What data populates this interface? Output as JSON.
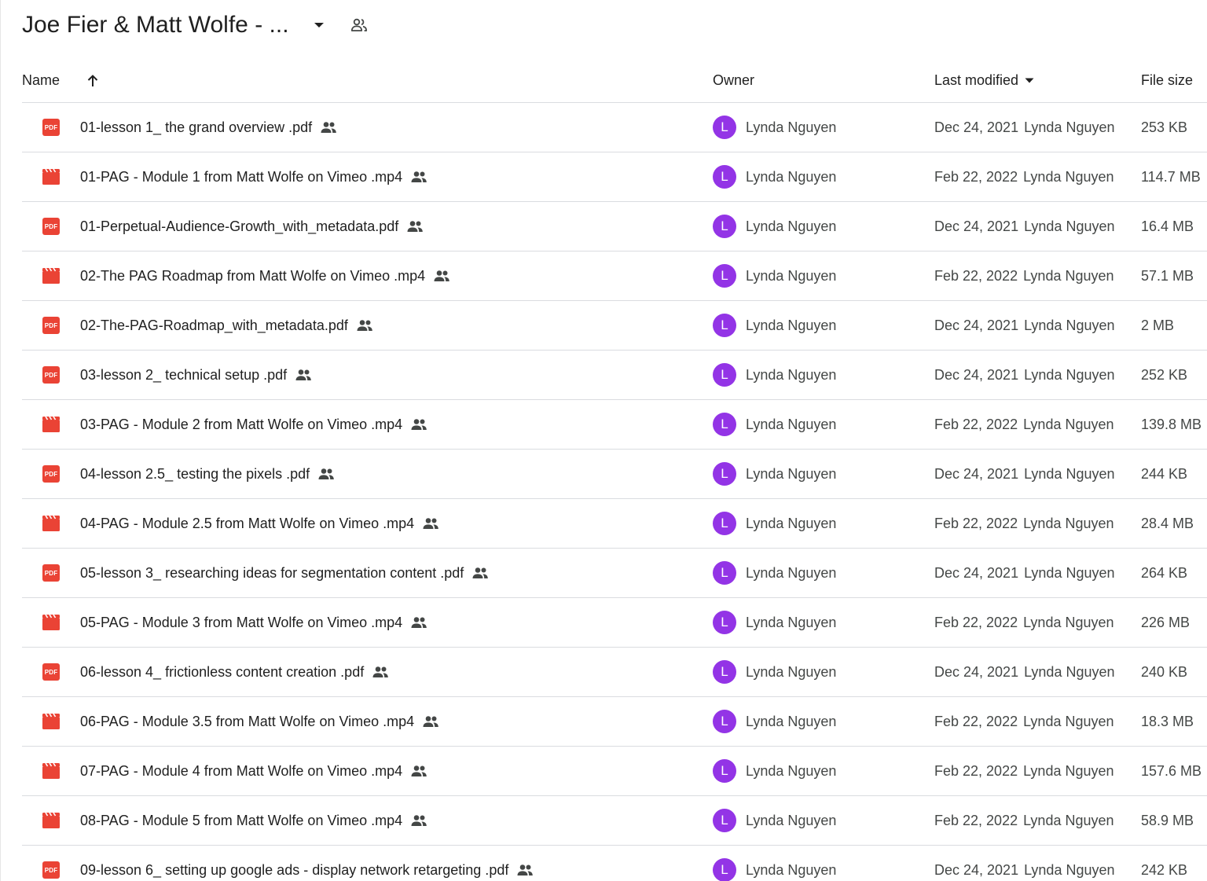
{
  "folder": {
    "title": "Joe Fier & Matt Wolfe - ..."
  },
  "columns": {
    "name": "Name",
    "owner": "Owner",
    "last_modified": "Last modified",
    "file_size": "File size"
  },
  "colors": {
    "pdf": "#ea4335",
    "video": "#ea4335",
    "avatar": "#9334e6",
    "divider": "#dadce0"
  },
  "files": [
    {
      "name": "01-lesson 1_ the grand overview .pdf",
      "type": "pdf",
      "icon": "pdf-icon",
      "owner_initial": "L",
      "owner": "Lynda Nguyen",
      "modified_date": "Dec 24, 2021",
      "modified_by": "Lynda Nguyen",
      "size": "253 KB"
    },
    {
      "name": "01-PAG - Module 1 from Matt Wolfe on Vimeo .mp4",
      "type": "video",
      "icon": "video-icon",
      "owner_initial": "L",
      "owner": "Lynda Nguyen",
      "modified_date": "Feb 22, 2022",
      "modified_by": "Lynda Nguyen",
      "size": "114.7 MB"
    },
    {
      "name": "01-Perpetual-Audience-Growth_with_metadata.pdf",
      "type": "pdf",
      "icon": "pdf-icon",
      "owner_initial": "L",
      "owner": "Lynda Nguyen",
      "modified_date": "Dec 24, 2021",
      "modified_by": "Lynda Nguyen",
      "size": "16.4 MB"
    },
    {
      "name": "02-The PAG Roadmap from Matt Wolfe on Vimeo .mp4",
      "type": "video",
      "icon": "video-icon",
      "owner_initial": "L",
      "owner": "Lynda Nguyen",
      "modified_date": "Feb 22, 2022",
      "modified_by": "Lynda Nguyen",
      "size": "57.1 MB"
    },
    {
      "name": "02-The-PAG-Roadmap_with_metadata.pdf",
      "type": "pdf",
      "icon": "pdf-icon",
      "owner_initial": "L",
      "owner": "Lynda Nguyen",
      "modified_date": "Dec 24, 2021",
      "modified_by": "Lynda Nguyen",
      "size": "2 MB"
    },
    {
      "name": "03-lesson 2_ technical setup .pdf",
      "type": "pdf",
      "icon": "pdf-icon",
      "owner_initial": "L",
      "owner": "Lynda Nguyen",
      "modified_date": "Dec 24, 2021",
      "modified_by": "Lynda Nguyen",
      "size": "252 KB"
    },
    {
      "name": "03-PAG - Module 2 from Matt Wolfe on Vimeo .mp4",
      "type": "video",
      "icon": "video-icon",
      "owner_initial": "L",
      "owner": "Lynda Nguyen",
      "modified_date": "Feb 22, 2022",
      "modified_by": "Lynda Nguyen",
      "size": "139.8 MB"
    },
    {
      "name": "04-lesson 2.5_ testing the pixels .pdf",
      "type": "pdf",
      "icon": "pdf-icon",
      "owner_initial": "L",
      "owner": "Lynda Nguyen",
      "modified_date": "Dec 24, 2021",
      "modified_by": "Lynda Nguyen",
      "size": "244 KB"
    },
    {
      "name": "04-PAG - Module 2.5 from Matt Wolfe on Vimeo .mp4",
      "type": "video",
      "icon": "video-icon",
      "owner_initial": "L",
      "owner": "Lynda Nguyen",
      "modified_date": "Feb 22, 2022",
      "modified_by": "Lynda Nguyen",
      "size": "28.4 MB"
    },
    {
      "name": "05-lesson 3_ researching ideas for segmentation content .pdf",
      "type": "pdf",
      "icon": "pdf-icon",
      "owner_initial": "L",
      "owner": "Lynda Nguyen",
      "modified_date": "Dec 24, 2021",
      "modified_by": "Lynda Nguyen",
      "size": "264 KB"
    },
    {
      "name": "05-PAG - Module 3 from Matt Wolfe on Vimeo .mp4",
      "type": "video",
      "icon": "video-icon",
      "owner_initial": "L",
      "owner": "Lynda Nguyen",
      "modified_date": "Feb 22, 2022",
      "modified_by": "Lynda Nguyen",
      "size": "226 MB"
    },
    {
      "name": "06-lesson 4_ frictionless content creation .pdf",
      "type": "pdf",
      "icon": "pdf-icon",
      "owner_initial": "L",
      "owner": "Lynda Nguyen",
      "modified_date": "Dec 24, 2021",
      "modified_by": "Lynda Nguyen",
      "size": "240 KB"
    },
    {
      "name": "06-PAG - Module 3.5 from Matt Wolfe on Vimeo .mp4",
      "type": "video",
      "icon": "video-icon",
      "owner_initial": "L",
      "owner": "Lynda Nguyen",
      "modified_date": "Feb 22, 2022",
      "modified_by": "Lynda Nguyen",
      "size": "18.3 MB"
    },
    {
      "name": "07-PAG - Module 4 from Matt Wolfe on Vimeo .mp4",
      "type": "video",
      "icon": "video-icon",
      "owner_initial": "L",
      "owner": "Lynda Nguyen",
      "modified_date": "Feb 22, 2022",
      "modified_by": "Lynda Nguyen",
      "size": "157.6 MB"
    },
    {
      "name": "08-PAG - Module 5 from Matt Wolfe on Vimeo .mp4",
      "type": "video",
      "icon": "video-icon",
      "owner_initial": "L",
      "owner": "Lynda Nguyen",
      "modified_date": "Feb 22, 2022",
      "modified_by": "Lynda Nguyen",
      "size": "58.9 MB"
    },
    {
      "name": "09-lesson 6_ setting up google ads - display network retargeting .pdf",
      "type": "pdf",
      "icon": "pdf-icon",
      "owner_initial": "L",
      "owner": "Lynda Nguyen",
      "modified_date": "Dec 24, 2021",
      "modified_by": "Lynda Nguyen",
      "size": "242 KB"
    }
  ]
}
